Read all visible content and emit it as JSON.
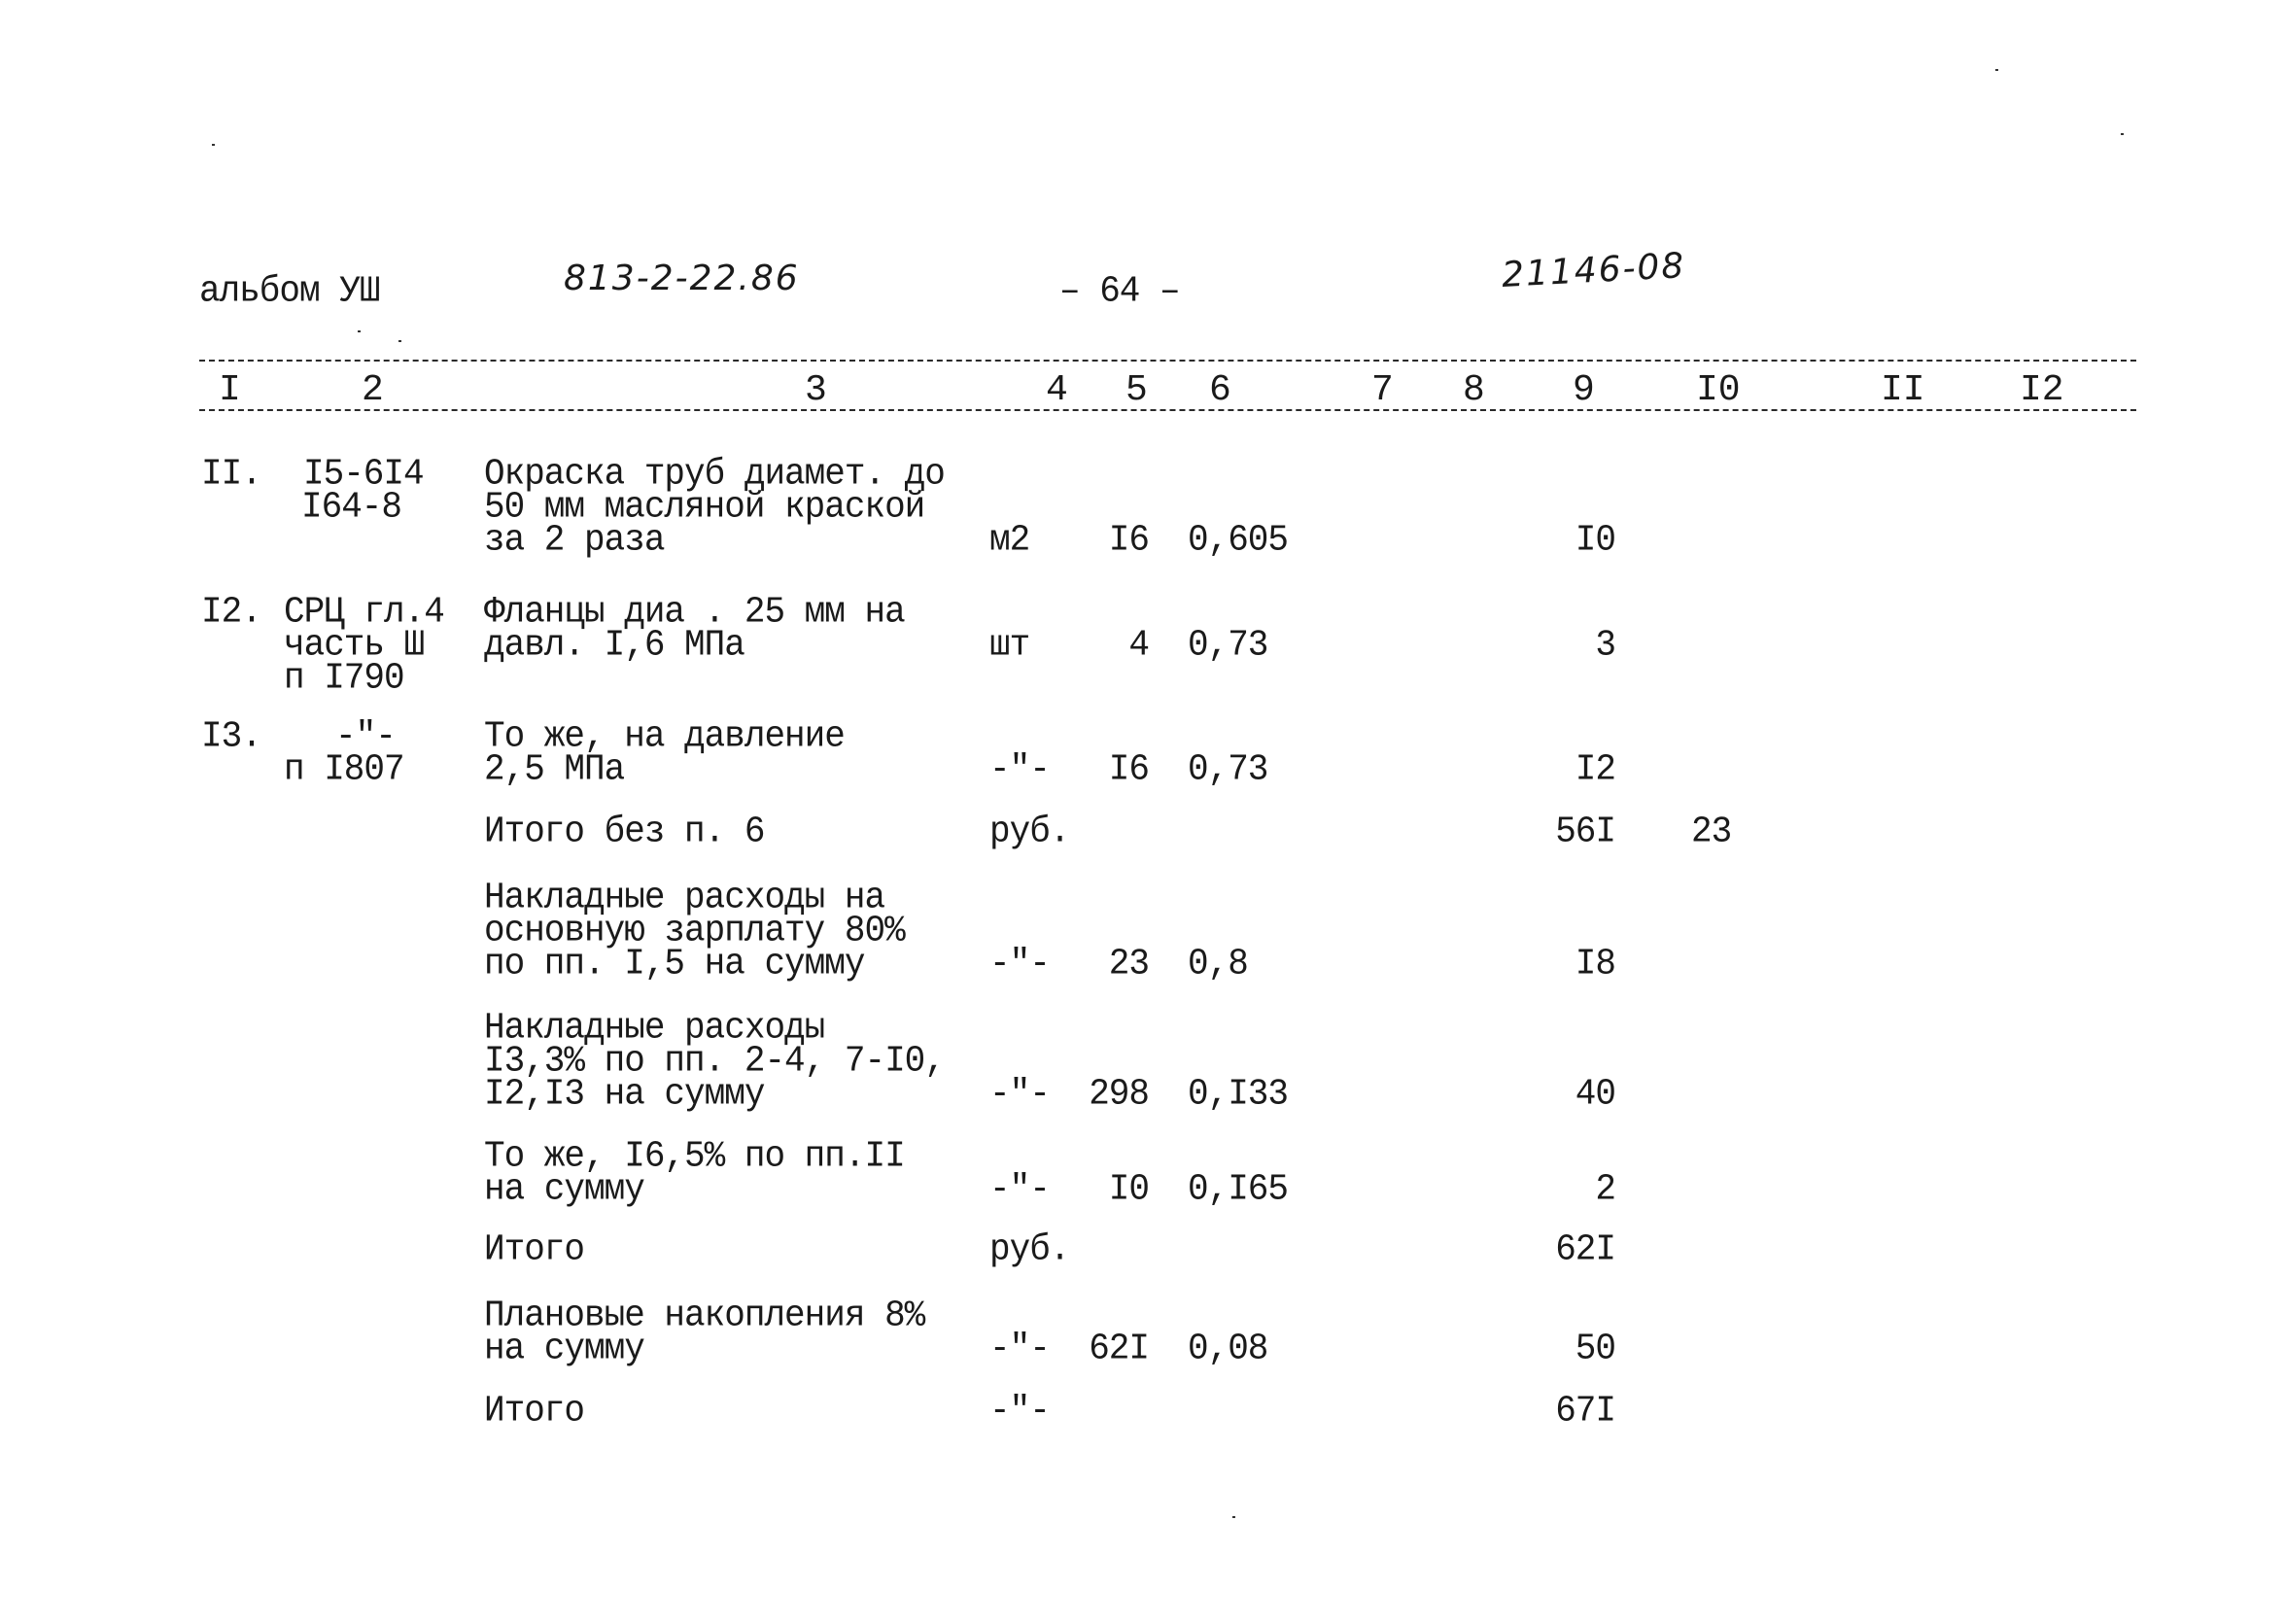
{
  "header": {
    "album": "альбом УШ",
    "project_code": "813-2-22.86",
    "page_number": "– 64 –",
    "document_code": "21146-08"
  },
  "columns": [
    "I",
    "2",
    "3",
    "4",
    "5",
    "6",
    "7",
    "8",
    "9",
    "I0",
    "II",
    "I2"
  ],
  "rows": [
    {
      "num": "II.",
      "ref": [
        "I5-6I4",
        "I64-8"
      ],
      "desc": [
        "Окраска труб диамет. до",
        "50 мм масляной краской",
        "за 2 раза"
      ],
      "unit": "м2",
      "qty": "I6",
      "rate": "0,605",
      "col9": "I0",
      "col10": ""
    },
    {
      "num": "I2.",
      "ref": [
        "СРЦ гл.4",
        "часть Ш",
        "п I790"
      ],
      "desc": [
        "Фланцы диа . 25 мм на",
        "давл. I,6 МПа"
      ],
      "unit": "шт",
      "qty": "4",
      "rate": "0,73",
      "col9": "3",
      "col10": ""
    },
    {
      "num": "I3.",
      "ref": [
        "-\"-",
        "п I807"
      ],
      "desc": [
        "То же, на давление",
        "2,5 МПа"
      ],
      "unit": "-\"-",
      "qty": "I6",
      "rate": "0,73",
      "col9": "I2",
      "col10": ""
    },
    {
      "num": "",
      "ref": [],
      "desc": [
        "Итого без п. 6"
      ],
      "unit": "руб.",
      "qty": "",
      "rate": "",
      "col9": "56I",
      "col10": "23"
    },
    {
      "num": "",
      "ref": [],
      "desc": [
        "Накладные расходы на",
        "основную зарплату 80%",
        "по пп. I,5 на сумму"
      ],
      "unit": "-\"-",
      "qty": "23",
      "rate": "0,8",
      "col9": "I8",
      "col10": ""
    },
    {
      "num": "",
      "ref": [],
      "desc": [
        "Накладные расходы",
        "I3,3% по пп. 2-4, 7-I0,",
        "I2,I3 на сумму"
      ],
      "unit": "-\"-",
      "qty": "298",
      "rate": "0,I33",
      "col9": "40",
      "col10": ""
    },
    {
      "num": "",
      "ref": [],
      "desc": [
        "То же, I6,5% по пп.II",
        "на сумму"
      ],
      "unit": "-\"-",
      "qty": "I0",
      "rate": "0,I65",
      "col9": "2",
      "col10": ""
    },
    {
      "num": "",
      "ref": [],
      "desc": [
        "Итого"
      ],
      "unit": "руб.",
      "qty": "",
      "rate": "",
      "col9": "62I",
      "col10": ""
    },
    {
      "num": "",
      "ref": [],
      "desc": [
        "Плановые накопления 8%",
        "на сумму"
      ],
      "unit": "-\"-",
      "qty": "62I",
      "rate": "0,08",
      "col9": "50",
      "col10": ""
    },
    {
      "num": "",
      "ref": [],
      "desc": [
        "Итого"
      ],
      "unit": "-\"-",
      "qty": "",
      "rate": "",
      "col9": "67I",
      "col10": ""
    }
  ]
}
